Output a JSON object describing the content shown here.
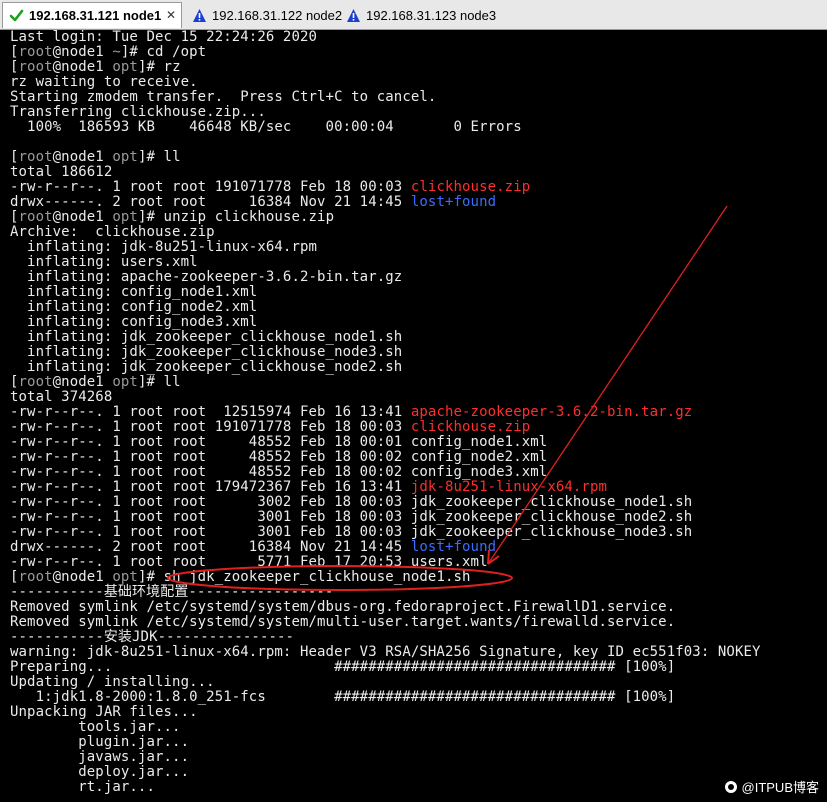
{
  "tabs": [
    {
      "label": "192.168.31.121 node1",
      "status": "check",
      "active": true
    },
    {
      "label": "192.168.31.122 node2",
      "status": "warning",
      "active": false
    },
    {
      "label": "192.168.31.123 node3",
      "status": "warning",
      "active": false
    }
  ],
  "terminal": {
    "lines": [
      [
        {
          "t": "Last login: Tue Dec 15 22:24:26 2020",
          "c": "txt"
        }
      ],
      [
        {
          "t": "[",
          "c": "brk"
        },
        {
          "t": "root",
          "c": "root"
        },
        {
          "t": "@node1 ",
          "c": "txt"
        },
        {
          "t": "~",
          "c": "root"
        },
        {
          "t": "]# cd /opt",
          "c": "txt"
        }
      ],
      [
        {
          "t": "[",
          "c": "brk"
        },
        {
          "t": "root",
          "c": "root"
        },
        {
          "t": "@node1 ",
          "c": "txt"
        },
        {
          "t": "opt",
          "c": "root"
        },
        {
          "t": "]# rz",
          "c": "txt"
        }
      ],
      [
        {
          "t": "rz waiting to receive.",
          "c": "txt"
        }
      ],
      [
        {
          "t": "Starting zmodem transfer.  Press Ctrl+C to cancel.",
          "c": "txt"
        }
      ],
      [
        {
          "t": "Transferring clickhouse.zip...",
          "c": "txt"
        }
      ],
      [
        {
          "t": "  100%  186593 KB    46648 KB/sec    00:00:04       0 Errors",
          "c": "txt"
        }
      ],
      [
        {
          "t": "",
          "c": "txt"
        }
      ],
      [
        {
          "t": "[",
          "c": "brk"
        },
        {
          "t": "root",
          "c": "root"
        },
        {
          "t": "@node1 ",
          "c": "txt"
        },
        {
          "t": "opt",
          "c": "root"
        },
        {
          "t": "]# ll",
          "c": "txt"
        }
      ],
      [
        {
          "t": "total 186612",
          "c": "txt"
        }
      ],
      [
        {
          "t": "-rw-r--r--. 1 root root 191071778 Feb 18 00:03 ",
          "c": "txt"
        },
        {
          "t": "clickhouse.zip",
          "c": "red"
        }
      ],
      [
        {
          "t": "drwx------. 2 root root     16384 Nov 21 14:45 ",
          "c": "txt"
        },
        {
          "t": "lost+found",
          "c": "blue"
        }
      ],
      [
        {
          "t": "[",
          "c": "brk"
        },
        {
          "t": "root",
          "c": "root"
        },
        {
          "t": "@node1 ",
          "c": "txt"
        },
        {
          "t": "opt",
          "c": "root"
        },
        {
          "t": "]# unzip clickhouse.zip",
          "c": "txt"
        }
      ],
      [
        {
          "t": "Archive:  clickhouse.zip",
          "c": "txt"
        }
      ],
      [
        {
          "t": "  inflating: jdk-8u251-linux-x64.rpm",
          "c": "txt"
        }
      ],
      [
        {
          "t": "  inflating: users.xml",
          "c": "txt"
        }
      ],
      [
        {
          "t": "  inflating: apache-zookeeper-3.6.2-bin.tar.gz",
          "c": "txt"
        }
      ],
      [
        {
          "t": "  inflating: config_node1.xml",
          "c": "txt"
        }
      ],
      [
        {
          "t": "  inflating: config_node2.xml",
          "c": "txt"
        }
      ],
      [
        {
          "t": "  inflating: config_node3.xml",
          "c": "txt"
        }
      ],
      [
        {
          "t": "  inflating: jdk_zookeeper_clickhouse_node1.sh",
          "c": "txt"
        }
      ],
      [
        {
          "t": "  inflating: jdk_zookeeper_clickhouse_node3.sh",
          "c": "txt"
        }
      ],
      [
        {
          "t": "  inflating: jdk_zookeeper_clickhouse_node2.sh",
          "c": "txt"
        }
      ],
      [
        {
          "t": "[",
          "c": "brk"
        },
        {
          "t": "root",
          "c": "root"
        },
        {
          "t": "@node1 ",
          "c": "txt"
        },
        {
          "t": "opt",
          "c": "root"
        },
        {
          "t": "]# ll",
          "c": "txt"
        }
      ],
      [
        {
          "t": "total 374268",
          "c": "txt"
        }
      ],
      [
        {
          "t": "-rw-r--r--. 1 root root  12515974 Feb 16 13:41 ",
          "c": "txt"
        },
        {
          "t": "apache-zookeeper-3.6.2-bin.tar.gz",
          "c": "red"
        }
      ],
      [
        {
          "t": "-rw-r--r--. 1 root root 191071778 Feb 18 00:03 ",
          "c": "txt"
        },
        {
          "t": "clickhouse.zip",
          "c": "red"
        }
      ],
      [
        {
          "t": "-rw-r--r--. 1 root root     48552 Feb 18 00:01 config_node1.xml",
          "c": "txt"
        }
      ],
      [
        {
          "t": "-rw-r--r--. 1 root root     48552 Feb 18 00:02 config_node2.xml",
          "c": "txt"
        }
      ],
      [
        {
          "t": "-rw-r--r--. 1 root root     48552 Feb 18 00:02 config_node3.xml",
          "c": "txt"
        }
      ],
      [
        {
          "t": "-rw-r--r--. 1 root root 179472367 Feb 16 13:41 ",
          "c": "txt"
        },
        {
          "t": "jdk-8u251-linux-x64.rpm",
          "c": "red"
        }
      ],
      [
        {
          "t": "-rw-r--r--. 1 root root      3002 Feb 18 00:03 jdk_zookeeper_clickhouse_node1.sh",
          "c": "txt"
        }
      ],
      [
        {
          "t": "-rw-r--r--. 1 root root      3001 Feb 18 00:03 jdk_zookeeper_clickhouse_node2.sh",
          "c": "txt"
        }
      ],
      [
        {
          "t": "-rw-r--r--. 1 root root      3001 Feb 18 00:03 jdk_zookeeper_clickhouse_node3.sh",
          "c": "txt"
        }
      ],
      [
        {
          "t": "drwx------. 2 root root     16384 Nov 21 14:45 ",
          "c": "txt"
        },
        {
          "t": "lost+found",
          "c": "blue"
        }
      ],
      [
        {
          "t": "-rw-r--r--. 1 root root      5771 Feb 17 20:53 users.xml",
          "c": "txt"
        }
      ],
      [
        {
          "t": "[",
          "c": "brk"
        },
        {
          "t": "root",
          "c": "root"
        },
        {
          "t": "@node1 ",
          "c": "txt"
        },
        {
          "t": "opt",
          "c": "root"
        },
        {
          "t": "]# sh jdk_zookeeper_clickhouse_node1.sh",
          "c": "txt"
        }
      ],
      [
        {
          "t": "-----------基础环境配置-----------------",
          "c": "txt"
        }
      ],
      [
        {
          "t": "Removed symlink /etc/systemd/system/dbus-org.fedoraproject.FirewallD1.service.",
          "c": "txt"
        }
      ],
      [
        {
          "t": "Removed symlink /etc/systemd/system/multi-user.target.wants/firewalld.service.",
          "c": "txt"
        }
      ],
      [
        {
          "t": "-----------安装JDK----------------",
          "c": "txt"
        }
      ],
      [
        {
          "t": "warning: jdk-8u251-linux-x64.rpm: Header V3 RSA/SHA256 Signature, key ID ec551f03: NOKEY",
          "c": "txt"
        }
      ],
      [
        {
          "t": "Preparing...                          ################################# [100%]",
          "c": "txt"
        }
      ],
      [
        {
          "t": "Updating / installing...",
          "c": "txt"
        }
      ],
      [
        {
          "t": "   1:jdk1.8-2000:1.8.0_251-fcs        ################################# [100%]",
          "c": "txt"
        }
      ],
      [
        {
          "t": "Unpacking JAR files...",
          "c": "txt"
        }
      ],
      [
        {
          "t": "        tools.jar...",
          "c": "txt"
        }
      ],
      [
        {
          "t": "        plugin.jar...",
          "c": "txt"
        }
      ],
      [
        {
          "t": "        javaws.jar...",
          "c": "txt"
        }
      ],
      [
        {
          "t": "        deploy.jar...",
          "c": "txt"
        }
      ],
      [
        {
          "t": "        rt.jar...",
          "c": "txt"
        }
      ]
    ]
  },
  "annotation": {
    "color": "#e02020"
  },
  "watermark": {
    "text": "@ITPUB博客"
  }
}
